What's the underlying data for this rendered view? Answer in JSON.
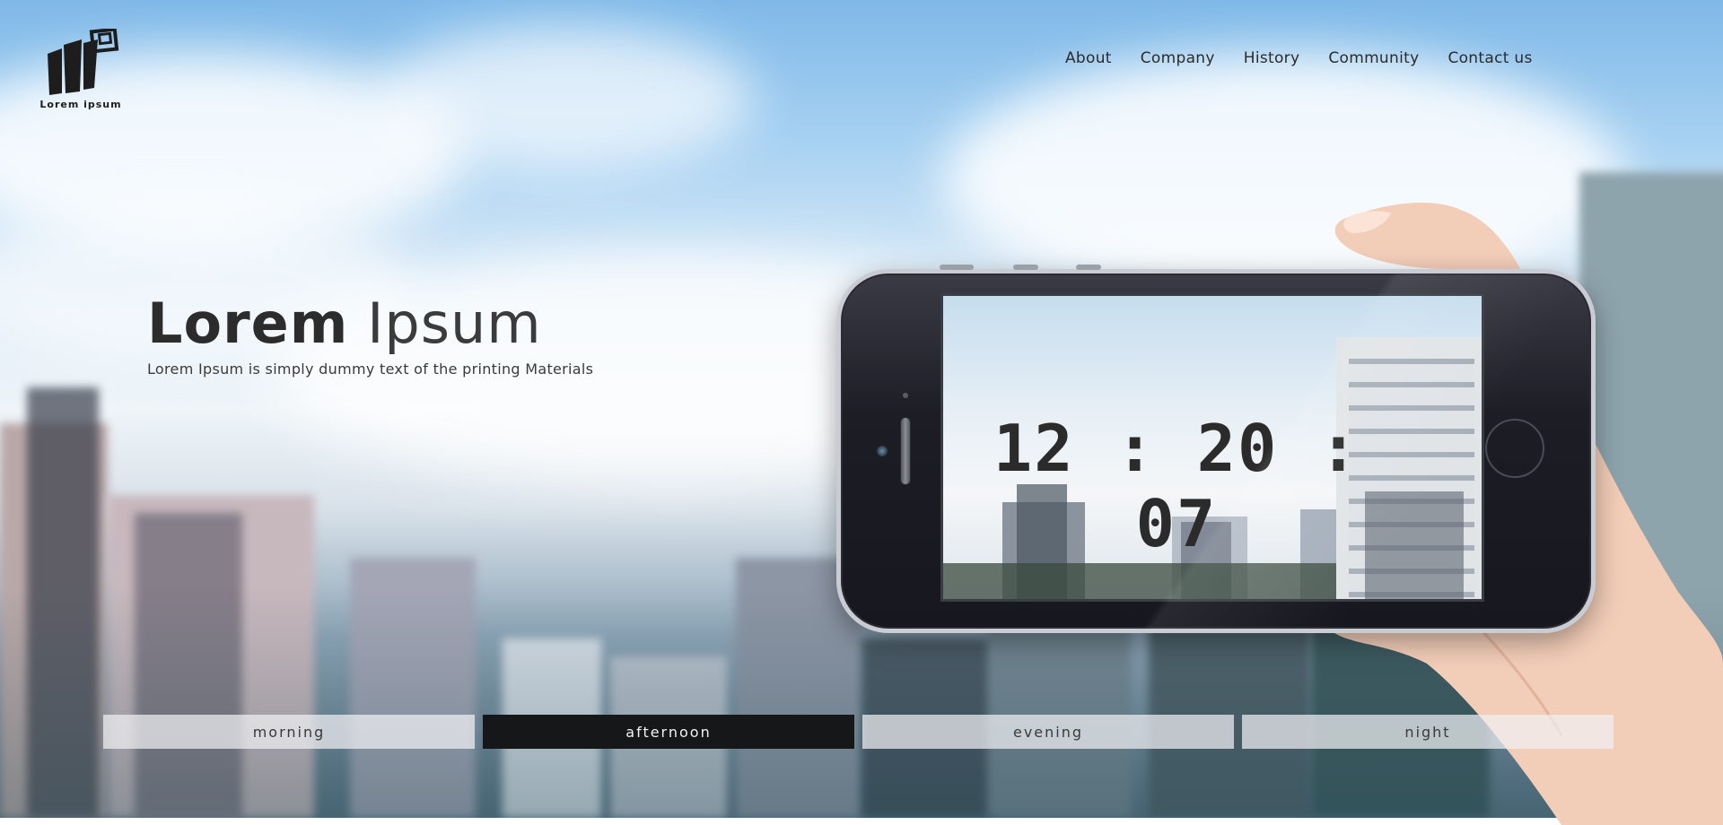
{
  "logo": {
    "text": "Lorem ipsum"
  },
  "nav": [
    {
      "label": "About"
    },
    {
      "label": "Company"
    },
    {
      "label": "History"
    },
    {
      "label": "Community"
    },
    {
      "label": "Contact us"
    }
  ],
  "hero": {
    "title_bold": "Lorem",
    "title_light": "Ipsum",
    "subtitle": "Lorem Ipsum is simply dummy text of the printing Materials"
  },
  "phone": {
    "clock": "12 : 20 : 07"
  },
  "tabs": [
    {
      "label": "morning",
      "active": false
    },
    {
      "label": "afternoon",
      "active": true
    },
    {
      "label": "evening",
      "active": false
    },
    {
      "label": "night",
      "active": false
    }
  ],
  "colors": {
    "active_tab": "#161719",
    "inactive_tab": "#f0f0f3",
    "text_dark": "#2b2b2b"
  }
}
